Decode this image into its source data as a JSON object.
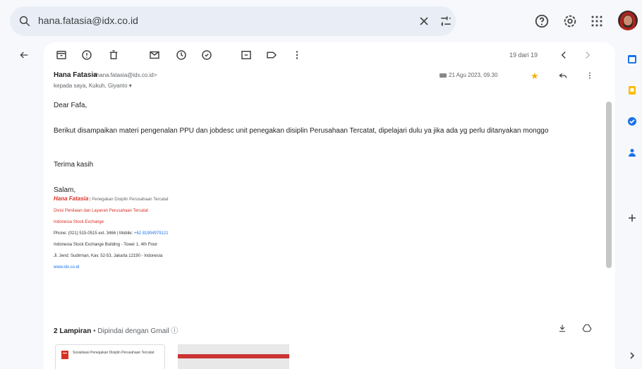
{
  "search": {
    "value": "hana.fatasia@idx.co.id"
  },
  "toolbar": {
    "pager": "19 dari 19"
  },
  "message": {
    "sender_name": "Hana Fatasia",
    "sender_email": "<hana.fatasia@idx.co.id>",
    "to_line": "kepada saya, Kukuh, Giyanto ▾",
    "date": "21 Agu 2023, 09.30",
    "greeting": "Dear Fafa,",
    "paragraph_1": "Berikut disampaikan materi pengenalan PPU dan jobdesc unit penegakan disiplin Perusahaan Tercatat, dipelajari dulu ya jika ada yg perlu ditanyakan monggo",
    "thanks": "Terima kasih",
    "salam": "Salam,"
  },
  "signature": {
    "name": "Hana Fatasia",
    "title": "|  Penegakan Disiplin Perusahaan Tercatat",
    "division": "Divisi Penilaian dan Layanan Perusahaan Tercatat",
    "company": "Indonesia Stock Exchange",
    "phone_prefix": "Phone: (021) 515-0515 ext. 3466 | Mobile:",
    "mobile": "+62 81904979121",
    "building": "Indonesia Stock Exchange Building - Tower 1, 4th Floor",
    "address": "Jl. Jend. Sudirman, Kav. 52-53, Jakarta 12190 - Indonesia",
    "website": "www.idx.co.id"
  },
  "attachments": {
    "count_label": "2 Lampiran",
    "scanned": "•  Dipindai dengan Gmail ⓘ",
    "file1_title": "Sosialisasi Penegakan Disiplin Perusahaan Tercatat"
  },
  "colors": {
    "accent": "#1a73e8",
    "star": "#f4b400",
    "brand_red": "#d93025"
  }
}
